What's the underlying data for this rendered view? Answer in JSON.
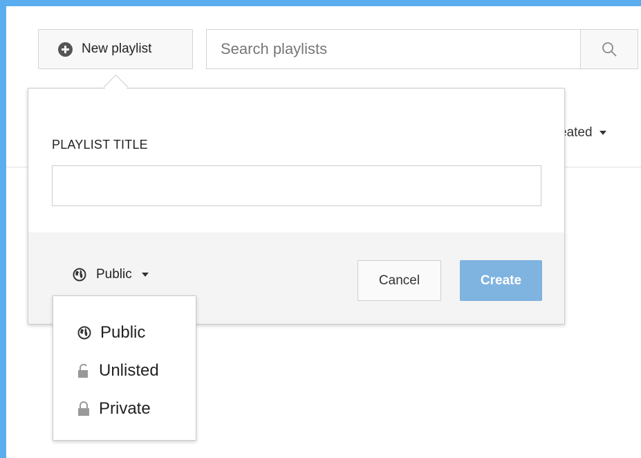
{
  "toolbar": {
    "new_playlist_label": "New playlist",
    "search_placeholder": "Search playlists"
  },
  "background": {
    "sort_label_partial": "eated"
  },
  "dialog": {
    "field_label": "PLAYLIST TITLE",
    "title_value": "",
    "privacy_selected": "Public",
    "cancel_label": "Cancel",
    "create_label": "Create"
  },
  "privacy_menu": {
    "options": [
      {
        "label": "Public",
        "icon": "globe-icon"
      },
      {
        "label": "Unlisted",
        "icon": "unlocked-icon"
      },
      {
        "label": "Private",
        "icon": "lock-icon"
      }
    ]
  },
  "colors": {
    "page_border": "#5aaeef",
    "create_button": "#7fb3e0",
    "footer_bg": "#f4f4f4"
  }
}
